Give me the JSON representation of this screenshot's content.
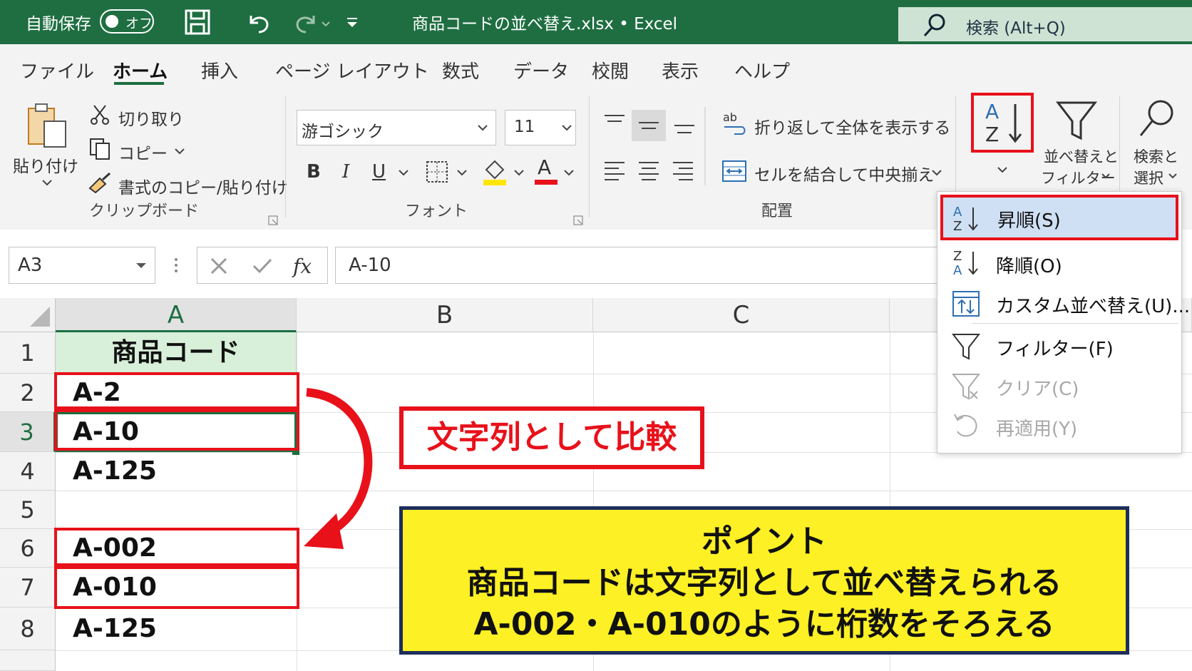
{
  "titlebar": {
    "autosave_label": "自動保存",
    "toggle_label": "オフ",
    "title": "商品コードの並べ替え.xlsx • Excel",
    "search_placeholder": "検索 (Alt+Q)"
  },
  "tabs": [
    "ファイル",
    "ホーム",
    "挿入",
    "ページ レイアウト",
    "数式",
    "データ",
    "校閲",
    "表示",
    "ヘルプ"
  ],
  "ribbon": {
    "paste_label": "貼り付け",
    "cut_label": "切り取り",
    "copy_label": "コピー",
    "format_painter_label": "書式のコピー/貼り付け",
    "clipboard_group": "クリップボード",
    "font_name": "游ゴシック",
    "font_size": "11",
    "font_group": "フォント",
    "bold": "B",
    "italic": "I",
    "underline": "U",
    "font_color_letter": "A",
    "wrap_text_label": "折り返して全体を表示する",
    "merge_center_label": "セルを結合して中央揃え",
    "alignment_group": "配置",
    "sort_filter_label_1": "並べ替えと",
    "sort_filter_label_2": "フィルター",
    "find_select_label_1": "検索と",
    "find_select_label_2": "選択"
  },
  "formula_bar": {
    "name_box": "A3",
    "fx": "fx",
    "formula": "A-10"
  },
  "grid": {
    "columns": [
      "A",
      "B",
      "C"
    ],
    "rows": [
      "1",
      "2",
      "3",
      "4",
      "5",
      "6",
      "7",
      "8"
    ],
    "cells": [
      "商品コード",
      "A-2",
      "A-10",
      "A-125",
      "",
      "A-002",
      "A-010",
      "A-125"
    ]
  },
  "sort_menu": {
    "items": [
      "昇順(S)",
      "降順(O)",
      "カスタム並べ替え(U)...",
      "フィルター(F)",
      "クリア(C)",
      "再適用(Y)"
    ]
  },
  "annotations": {
    "compare_label": "文字列として比較",
    "point_title": "ポイント",
    "point_line1": "商品コードは文字列として並べ替えられる",
    "point_line2": "A-002・A-010のように桁数をそろえる"
  },
  "colors": {
    "excel_green": "#1e6e41",
    "highlight_red": "#e8111a",
    "callout_yellow": "#fdf024",
    "callout_border": "#1d2e5c",
    "header_cell_fill": "#d8efd9",
    "menu_highlight": "#cfe0f5"
  }
}
